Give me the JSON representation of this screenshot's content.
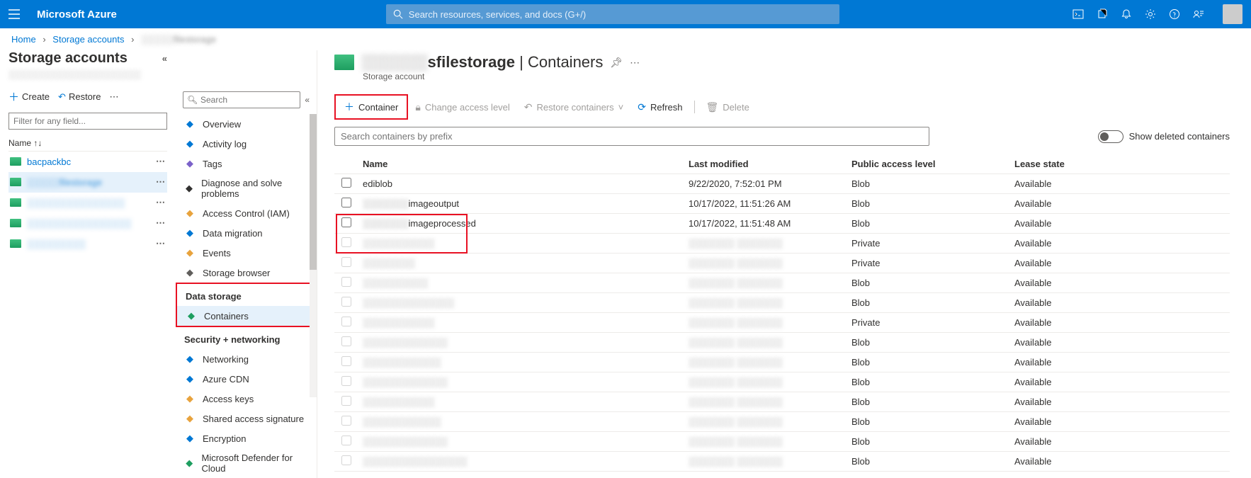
{
  "topbar": {
    "brand": "Microsoft Azure",
    "search_placeholder": "Search resources, services, and docs (G+/)"
  },
  "breadcrumb": {
    "items": [
      "Home",
      "Storage accounts",
      "░░░░░filestorage"
    ]
  },
  "left": {
    "title": "Storage accounts",
    "create": "Create",
    "restore": "Restore",
    "filter_placeholder": "Filter for any field...",
    "col_name": "Name ↑↓",
    "accounts": [
      {
        "label": "bacpackbc",
        "blurred": false,
        "selected": false
      },
      {
        "label": "░░░░░filestorage",
        "blurred": true,
        "selected": true,
        "labelSuffix": "filestorage"
      },
      {
        "label": "░░░░░░░░░░░░░░░",
        "blurred": true,
        "selected": false
      },
      {
        "label": "░░░░░░░░░░░░░░░░",
        "blurred": true,
        "selected": false
      },
      {
        "label": "░░░░░░░░░",
        "blurred": true,
        "selected": false
      }
    ]
  },
  "mid": {
    "search_placeholder": "Search",
    "sections": [
      {
        "type": "item",
        "icon": "overview-icon",
        "label": "Overview",
        "color": "#0078d4"
      },
      {
        "type": "item",
        "icon": "activity-log-icon",
        "label": "Activity log",
        "color": "#0078d4"
      },
      {
        "type": "item",
        "icon": "tags-icon",
        "label": "Tags",
        "color": "#7b61c9"
      },
      {
        "type": "item",
        "icon": "diagnose-icon",
        "label": "Diagnose and solve problems",
        "color": "#323130"
      },
      {
        "type": "item",
        "icon": "access-control-icon",
        "label": "Access Control (IAM)",
        "color": "#e8a33d"
      },
      {
        "type": "item",
        "icon": "data-migration-icon",
        "label": "Data migration",
        "color": "#0078d4"
      },
      {
        "type": "item",
        "icon": "events-icon",
        "label": "Events",
        "color": "#e8a33d"
      },
      {
        "type": "item",
        "icon": "storage-browser-icon",
        "label": "Storage browser",
        "color": "#605e5c"
      },
      {
        "type": "section",
        "label": "Data storage",
        "redbox": true
      },
      {
        "type": "item",
        "icon": "containers-icon",
        "label": "Containers",
        "selected": true,
        "redbox": true,
        "color": "#1e9e60"
      },
      {
        "type": "section",
        "label": "Security + networking"
      },
      {
        "type": "item",
        "icon": "networking-icon",
        "label": "Networking",
        "color": "#0078d4"
      },
      {
        "type": "item",
        "icon": "azure-cdn-icon",
        "label": "Azure CDN",
        "color": "#0078d4"
      },
      {
        "type": "item",
        "icon": "access-keys-icon",
        "label": "Access keys",
        "color": "#e8a33d"
      },
      {
        "type": "item",
        "icon": "sas-icon",
        "label": "Shared access signature",
        "color": "#e8a33d"
      },
      {
        "type": "item",
        "icon": "encryption-icon",
        "label": "Encryption",
        "color": "#0078d4"
      },
      {
        "type": "item",
        "icon": "defender-icon",
        "label": "Microsoft Defender for Cloud",
        "color": "#1e9e60"
      }
    ]
  },
  "main": {
    "title_blur": "░░░░░░",
    "title_rest": "sfilestorage",
    "title_suffix": " | Containers",
    "subtitle": "Storage account",
    "toolbar": {
      "container": "Container",
      "access": "Change access level",
      "restore": "Restore containers",
      "refresh": "Refresh",
      "delete": "Delete"
    },
    "filter_placeholder": "Search containers by prefix",
    "toggle_label": "Show deleted containers",
    "columns": {
      "name": "Name",
      "modified": "Last modified",
      "access": "Public access level",
      "lease": "Lease state"
    },
    "rows": [
      {
        "name_prefix": "",
        "name": "ediblob",
        "modified": "9/22/2020, 7:52:01 PM",
        "access": "Blob",
        "lease": "Available",
        "redbox": false,
        "blurred": false
      },
      {
        "name_prefix": "░░░░░░░",
        "name": "imageoutput",
        "modified": "10/17/2022, 11:51:26 AM",
        "access": "Blob",
        "lease": "Available",
        "redbox": true,
        "blurred": false
      },
      {
        "name_prefix": "░░░░░░░",
        "name": "imageprocessed",
        "modified": "10/17/2022, 11:51:48 AM",
        "access": "Blob",
        "lease": "Available",
        "redbox": true,
        "blurred": false
      },
      {
        "name_prefix": "",
        "name": "░░░░░░░░░░░",
        "modified": "░░░░░░░ ░░░░░░░",
        "access": "Private",
        "lease": "Available",
        "blurred": true
      },
      {
        "name_prefix": "",
        "name": "░░░░░░░░",
        "modified": "░░░░░░░ ░░░░░░░",
        "access": "Private",
        "lease": "Available",
        "blurred": true
      },
      {
        "name_prefix": "",
        "name": "░░░░░░░░░░",
        "modified": "░░░░░░░ ░░░░░░░",
        "access": "Blob",
        "lease": "Available",
        "blurred": true
      },
      {
        "name_prefix": "",
        "name": "░░░░░░░░░░░░░░",
        "modified": "░░░░░░░ ░░░░░░░",
        "access": "Blob",
        "lease": "Available",
        "blurred": true
      },
      {
        "name_prefix": "",
        "name": "░░░░░░░░░░░",
        "modified": "░░░░░░░ ░░░░░░░",
        "access": "Private",
        "lease": "Available",
        "blurred": true
      },
      {
        "name_prefix": "",
        "name": "░░░░░░░░░░░░░",
        "modified": "░░░░░░░ ░░░░░░░",
        "access": "Blob",
        "lease": "Available",
        "blurred": true
      },
      {
        "name_prefix": "",
        "name": "░░░░░░░░░░░░",
        "modified": "░░░░░░░ ░░░░░░░",
        "access": "Blob",
        "lease": "Available",
        "blurred": true
      },
      {
        "name_prefix": "",
        "name": "░░░░░░░░░░░░░",
        "modified": "░░░░░░░ ░░░░░░░",
        "access": "Blob",
        "lease": "Available",
        "blurred": true
      },
      {
        "name_prefix": "",
        "name": "░░░░░░░░░░░",
        "modified": "░░░░░░░ ░░░░░░░",
        "access": "Blob",
        "lease": "Available",
        "blurred": true
      },
      {
        "name_prefix": "",
        "name": "░░░░░░░░░░░░",
        "modified": "░░░░░░░ ░░░░░░░",
        "access": "Blob",
        "lease": "Available",
        "blurred": true
      },
      {
        "name_prefix": "",
        "name": "░░░░░░░░░░░░░",
        "modified": "░░░░░░░ ░░░░░░░",
        "access": "Blob",
        "lease": "Available",
        "blurred": true
      },
      {
        "name_prefix": "",
        "name": "░░░░░░░░░░░░░░░░",
        "modified": "░░░░░░░ ░░░░░░░",
        "access": "Blob",
        "lease": "Available",
        "blurred": true
      }
    ]
  }
}
